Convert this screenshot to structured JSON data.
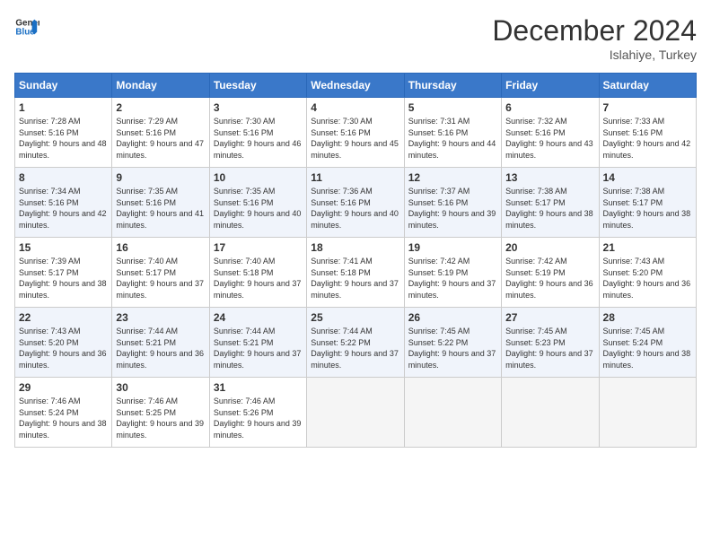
{
  "header": {
    "logo_line1": "General",
    "logo_line2": "Blue",
    "month": "December 2024",
    "location": "Islahiye, Turkey"
  },
  "days_of_week": [
    "Sunday",
    "Monday",
    "Tuesday",
    "Wednesday",
    "Thursday",
    "Friday",
    "Saturday"
  ],
  "weeks": [
    [
      {
        "day": "1",
        "sunrise": "7:28 AM",
        "sunset": "5:16 PM",
        "daylight": "9 hours and 48 minutes."
      },
      {
        "day": "2",
        "sunrise": "7:29 AM",
        "sunset": "5:16 PM",
        "daylight": "9 hours and 47 minutes."
      },
      {
        "day": "3",
        "sunrise": "7:30 AM",
        "sunset": "5:16 PM",
        "daylight": "9 hours and 46 minutes."
      },
      {
        "day": "4",
        "sunrise": "7:30 AM",
        "sunset": "5:16 PM",
        "daylight": "9 hours and 45 minutes."
      },
      {
        "day": "5",
        "sunrise": "7:31 AM",
        "sunset": "5:16 PM",
        "daylight": "9 hours and 44 minutes."
      },
      {
        "day": "6",
        "sunrise": "7:32 AM",
        "sunset": "5:16 PM",
        "daylight": "9 hours and 43 minutes."
      },
      {
        "day": "7",
        "sunrise": "7:33 AM",
        "sunset": "5:16 PM",
        "daylight": "9 hours and 42 minutes."
      }
    ],
    [
      {
        "day": "8",
        "sunrise": "7:34 AM",
        "sunset": "5:16 PM",
        "daylight": "9 hours and 42 minutes."
      },
      {
        "day": "9",
        "sunrise": "7:35 AM",
        "sunset": "5:16 PM",
        "daylight": "9 hours and 41 minutes."
      },
      {
        "day": "10",
        "sunrise": "7:35 AM",
        "sunset": "5:16 PM",
        "daylight": "9 hours and 40 minutes."
      },
      {
        "day": "11",
        "sunrise": "7:36 AM",
        "sunset": "5:16 PM",
        "daylight": "9 hours and 40 minutes."
      },
      {
        "day": "12",
        "sunrise": "7:37 AM",
        "sunset": "5:16 PM",
        "daylight": "9 hours and 39 minutes."
      },
      {
        "day": "13",
        "sunrise": "7:38 AM",
        "sunset": "5:17 PM",
        "daylight": "9 hours and 38 minutes."
      },
      {
        "day": "14",
        "sunrise": "7:38 AM",
        "sunset": "5:17 PM",
        "daylight": "9 hours and 38 minutes."
      }
    ],
    [
      {
        "day": "15",
        "sunrise": "7:39 AM",
        "sunset": "5:17 PM",
        "daylight": "9 hours and 38 minutes."
      },
      {
        "day": "16",
        "sunrise": "7:40 AM",
        "sunset": "5:17 PM",
        "daylight": "9 hours and 37 minutes."
      },
      {
        "day": "17",
        "sunrise": "7:40 AM",
        "sunset": "5:18 PM",
        "daylight": "9 hours and 37 minutes."
      },
      {
        "day": "18",
        "sunrise": "7:41 AM",
        "sunset": "5:18 PM",
        "daylight": "9 hours and 37 minutes."
      },
      {
        "day": "19",
        "sunrise": "7:42 AM",
        "sunset": "5:19 PM",
        "daylight": "9 hours and 37 minutes."
      },
      {
        "day": "20",
        "sunrise": "7:42 AM",
        "sunset": "5:19 PM",
        "daylight": "9 hours and 36 minutes."
      },
      {
        "day": "21",
        "sunrise": "7:43 AM",
        "sunset": "5:20 PM",
        "daylight": "9 hours and 36 minutes."
      }
    ],
    [
      {
        "day": "22",
        "sunrise": "7:43 AM",
        "sunset": "5:20 PM",
        "daylight": "9 hours and 36 minutes."
      },
      {
        "day": "23",
        "sunrise": "7:44 AM",
        "sunset": "5:21 PM",
        "daylight": "9 hours and 36 minutes."
      },
      {
        "day": "24",
        "sunrise": "7:44 AM",
        "sunset": "5:21 PM",
        "daylight": "9 hours and 37 minutes."
      },
      {
        "day": "25",
        "sunrise": "7:44 AM",
        "sunset": "5:22 PM",
        "daylight": "9 hours and 37 minutes."
      },
      {
        "day": "26",
        "sunrise": "7:45 AM",
        "sunset": "5:22 PM",
        "daylight": "9 hours and 37 minutes."
      },
      {
        "day": "27",
        "sunrise": "7:45 AM",
        "sunset": "5:23 PM",
        "daylight": "9 hours and 37 minutes."
      },
      {
        "day": "28",
        "sunrise": "7:45 AM",
        "sunset": "5:24 PM",
        "daylight": "9 hours and 38 minutes."
      }
    ],
    [
      {
        "day": "29",
        "sunrise": "7:46 AM",
        "sunset": "5:24 PM",
        "daylight": "9 hours and 38 minutes."
      },
      {
        "day": "30",
        "sunrise": "7:46 AM",
        "sunset": "5:25 PM",
        "daylight": "9 hours and 39 minutes."
      },
      {
        "day": "31",
        "sunrise": "7:46 AM",
        "sunset": "5:26 PM",
        "daylight": "9 hours and 39 minutes."
      },
      null,
      null,
      null,
      null
    ]
  ]
}
